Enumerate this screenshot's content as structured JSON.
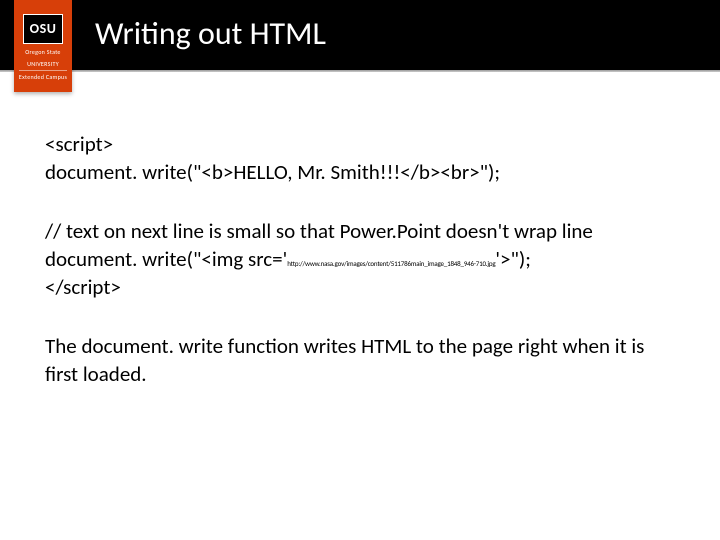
{
  "logo": {
    "initials": "OSU",
    "line1": "Oregon State",
    "line2": "UNIVERSITY",
    "line3": "Extended Campus"
  },
  "title": "Writing out HTML",
  "code": {
    "line1": "<script>",
    "line2": "document. write(\"<b>HELLO, Mr. Smith!!!</b><br>\");",
    "comment": "// text on next line is small so that Power.Point doesn't wrap line",
    "line3a": "document. write(\"<img src='",
    "url": "http://www.nasa.gov/images/content/511786main_image_1848_946-710.jpg",
    "line3b": "'>\");",
    "line4": "</script>"
  },
  "explanation": "The document. write function writes HTML to the page right when it is first loaded."
}
